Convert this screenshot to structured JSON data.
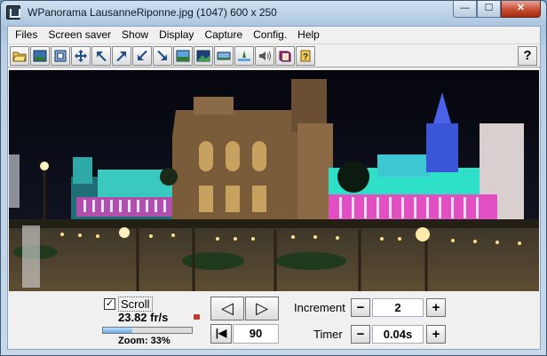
{
  "window": {
    "title": "WPanorama  LausanneRiponne.jpg   (1047) 600 x 250",
    "minimize_label": "—",
    "maximize_label": "☐",
    "close_label": "✕"
  },
  "menu": [
    "Files",
    "Screen saver",
    "Show",
    "Display",
    "Capture",
    "Config.",
    "Help"
  ],
  "toolbar": {
    "icons": [
      "open-file-icon",
      "picture-icon",
      "fit-window-icon",
      "move-arrows-icon",
      "arrow-up-left-icon",
      "arrow-up-right-icon",
      "arrow-down-left-icon",
      "arrow-down-right-icon",
      "scene-a-icon",
      "scene-b-icon",
      "scene-c-icon",
      "scene-d-icon",
      "sound-icon",
      "book-icon",
      "help-book-icon"
    ],
    "help_label": "?"
  },
  "scroll": {
    "checked": true,
    "check_mark": "✓",
    "label": "Scroll",
    "fps": "23.82 fr/s",
    "zoom_label": "Zoom: 33%",
    "zoom_value": 0.33
  },
  "navigation": {
    "prev_label": "◁",
    "next_label": "▷",
    "home_label": "|◀",
    "position_value": "90"
  },
  "increment": {
    "label": "Increment",
    "minus": "−",
    "plus": "+",
    "value": "2"
  },
  "timer": {
    "label": "Timer",
    "minus": "−",
    "plus": "+",
    "value": "0.04s"
  },
  "colors": {
    "photo_sky": "#0a0b14",
    "building_cyan": "#2fe0c8",
    "lights_pink": "#e24fc2"
  }
}
